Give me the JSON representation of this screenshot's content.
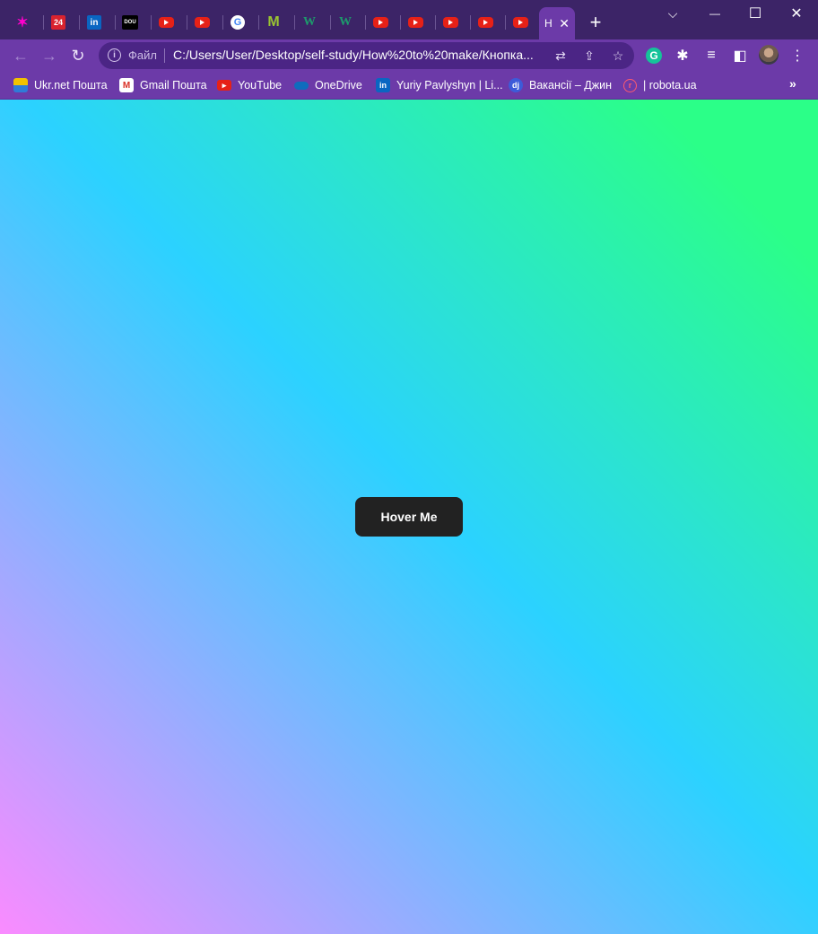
{
  "browser": {
    "tabs": [
      {
        "icon": "colorful-star-icon"
      },
      {
        "icon": "channel-24-icon",
        "text": "24"
      },
      {
        "icon": "linkedin-icon",
        "text": "in"
      },
      {
        "icon": "dou-icon",
        "text": "DOU"
      },
      {
        "icon": "youtube-icon"
      },
      {
        "icon": "youtube-icon"
      },
      {
        "icon": "google-icon",
        "text": "G"
      },
      {
        "icon": "m-icon",
        "text": "M"
      },
      {
        "icon": "w-icon",
        "text": "W"
      },
      {
        "icon": "w-icon",
        "text": "W"
      },
      {
        "icon": "youtube-icon"
      },
      {
        "icon": "youtube-icon"
      },
      {
        "icon": "youtube-icon"
      },
      {
        "icon": "youtube-icon"
      },
      {
        "icon": "youtube-icon"
      }
    ],
    "active_tab": {
      "title": "H",
      "close": "✕"
    },
    "new_tab": "+",
    "window_controls": {
      "dropdown": "⌵",
      "minimize": "—",
      "maximize": "☐",
      "close": "✕"
    },
    "omnibox": {
      "scheme_chip": "Файл",
      "url": "C:/Users/User/Desktop/self-study/How%20to%20make/Кнопка..."
    },
    "bookmarks": [
      {
        "label": "Ukr.net Пошта",
        "icon": "ukrnet-icon"
      },
      {
        "label": "Gmail Пошта",
        "icon": "gmail-icon"
      },
      {
        "label": "YouTube",
        "icon": "youtube-icon"
      },
      {
        "label": "OneDrive",
        "icon": "onedrive-icon"
      },
      {
        "label": "Yuriy Pavlyshyn | Li...",
        "icon": "linkedin-icon"
      },
      {
        "label": "Вакансії – Джин",
        "icon": "djinni-icon"
      },
      {
        "label": "| robota.ua",
        "icon": "robota-icon"
      }
    ],
    "bookmarks_more": "»",
    "accent_color": "#6c3aa8",
    "tabstrip_color": "#3c2467"
  },
  "page": {
    "button_label": "Hover Me",
    "gradient_colors": [
      "#fa8bff",
      "#2bd2ff",
      "#2bff88"
    ]
  }
}
